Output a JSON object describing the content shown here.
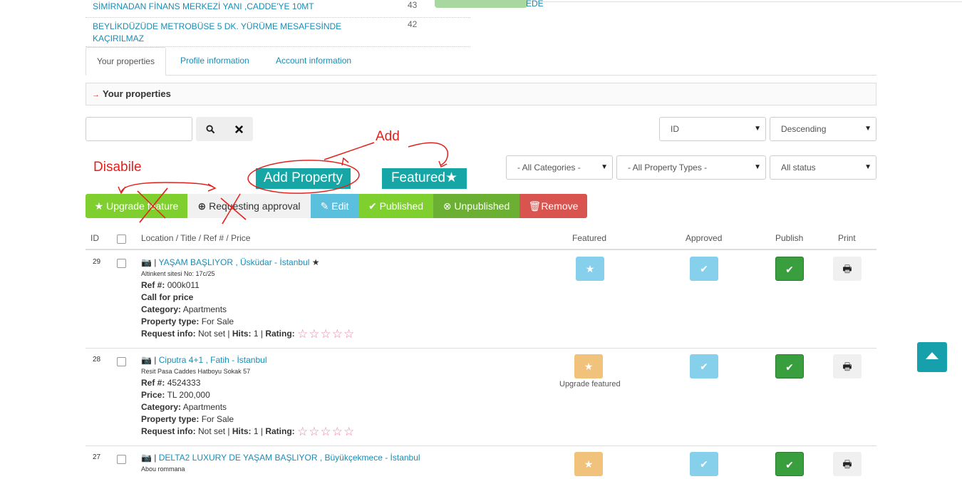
{
  "top_list": [
    {
      "title": "SİMİRNADAN FİNANS MERKEZİ YANI ,CADDE'YE 10MT",
      "count": "43"
    },
    {
      "title": "BEYLİKDÜZÜDE METROBÜSE 5 DK. YÜRÜME MESAFESİNDE KAÇIRILMAZ",
      "count": "42"
    }
  ],
  "top_right_text": "EDE",
  "tabs": [
    "Your properties",
    "Profile information",
    "Account information"
  ],
  "panel_title": "Your properties",
  "search": {
    "value": ""
  },
  "sort": {
    "field": "ID",
    "order": "Descending"
  },
  "filters": {
    "categories": "- All Categories -",
    "types": "- All Property Types -",
    "status": "All status"
  },
  "buttons": {
    "upgrade": "Upgrade feature",
    "request": "Requesting approval",
    "edit": "Edit",
    "publish": "Published",
    "unpublish": "Unpublished",
    "remove": "Remove"
  },
  "annotations": {
    "add": "Add",
    "disable": "Disabile",
    "add_property": "Add Property",
    "featured": "Featured"
  },
  "columns": {
    "id": "ID",
    "location": "Location / Title / Ref # / Price",
    "featured": "Featured",
    "approved": "Approved",
    "publish": "Publish",
    "print": "Print"
  },
  "labels": {
    "ref": "Ref #:",
    "price": "Price:",
    "category": "Category:",
    "ptype": "Property type:",
    "request": "Request info:",
    "hits": "Hits:",
    "rating": "Rating:",
    "upgrade_featured": "Upgrade featured"
  },
  "rows": [
    {
      "id": "29",
      "title": "YAŞAM BAŞLIYOR , Üsküdar - İstanbul",
      "address": "Altinkent sitesi No: 17c/25",
      "ref": "000k011",
      "price_text": "Call for price",
      "category": "Apartments",
      "ptype": "For Sale",
      "request": "Not set",
      "hits": "1"
    },
    {
      "id": "28",
      "title": "Ciputra 4+1 , Fatih - İstanbul",
      "address": "Resit Pasa Caddes Hatboyu Sokak 57",
      "ref": "4524333",
      "price": "TL 200,000",
      "category": "Apartments",
      "ptype": "For Sale",
      "request": "Not set",
      "hits": "1"
    },
    {
      "id": "27",
      "title": "DELTA2 LUXURY DE YAŞAM BAŞLIYOR , Büyükçekmece - İstanbul",
      "address": "Abou rommana"
    }
  ],
  "colors": {
    "accent": "#1a8cb5",
    "teal": "#16a6a6",
    "green": "#7fd02e",
    "red": "#d9534f"
  }
}
